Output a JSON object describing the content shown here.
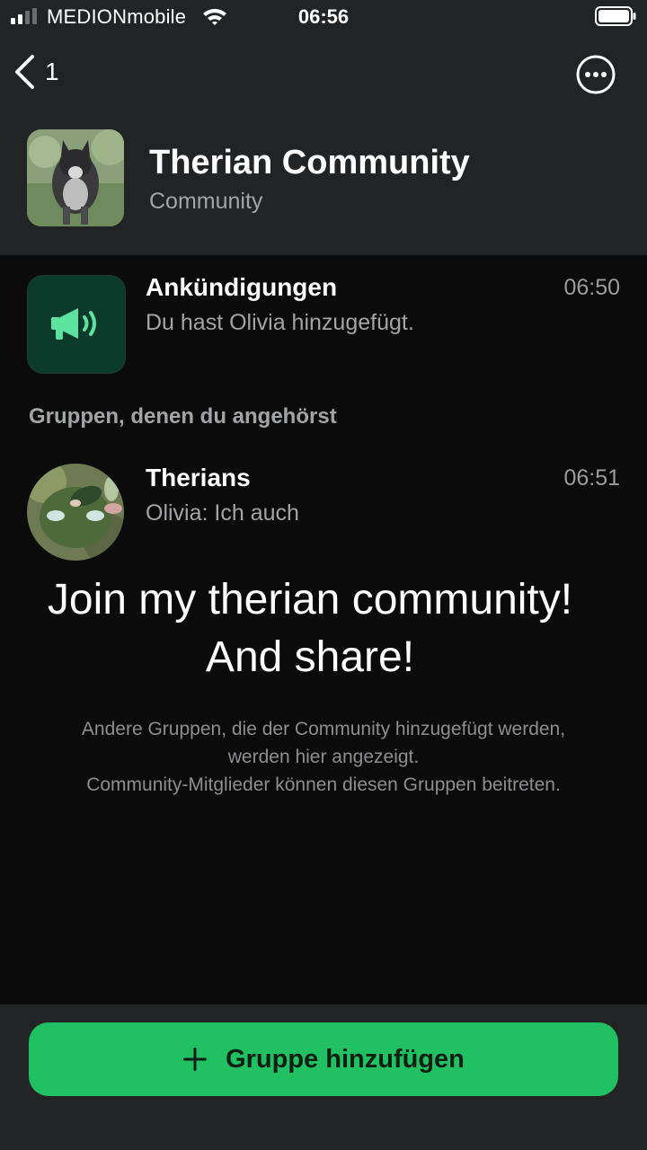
{
  "status_bar": {
    "carrier": "MEDIONmobile",
    "time": "06:56",
    "signal_icon": "signal-bars-icon",
    "wifi_icon": "wifi-icon",
    "battery_icon": "battery-icon"
  },
  "nav": {
    "back_count": "1",
    "back_icon": "chevron-left-icon",
    "more_icon": "ellipsis-circle-icon"
  },
  "community": {
    "title": "Therian Community",
    "subtitle": "Community"
  },
  "announcements": {
    "title": "Ankündigungen",
    "time": "06:50",
    "preview": "Du hast Olivia hinzugefügt.",
    "icon": "megaphone-icon"
  },
  "section_label": "Gruppen, denen du angehörst",
  "groups": [
    {
      "title": "Therians",
      "time": "06:51",
      "sender": "Olivia",
      "separator": ": ",
      "message": "Ich auch"
    }
  ],
  "overlay": {
    "line1": "Join my therian community!",
    "line2": "And share!"
  },
  "info": {
    "line1": "Andere Gruppen, die der Community hinzugefügt werden,",
    "line2": "werden hier angezeigt.",
    "line3": "Community-Mitglieder können diesen Gruppen beitreten."
  },
  "footer": {
    "add_group_label": "Gruppe hinzufügen",
    "add_icon": "plus-icon"
  },
  "colors": {
    "background": "#0b0b0b",
    "bar_background": "#222324",
    "accent_green": "#21c063",
    "announce_icon_bg": "#0c3b2b"
  }
}
